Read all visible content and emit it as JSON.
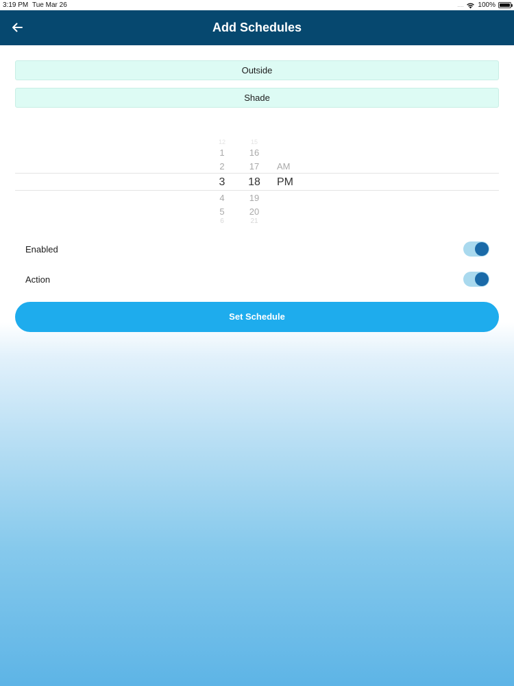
{
  "status_bar": {
    "time": "3:19 PM",
    "date": "Tue Mar 26",
    "signal": "....",
    "battery": "100%",
    "icons": [
      "wifi-icon",
      "battery-icon"
    ]
  },
  "nav": {
    "title": "Add Schedules",
    "back_icon": "arrow-left-icon",
    "color": "#06486f"
  },
  "fields": {
    "location": "Outside",
    "device": "Shade",
    "background": "#ddfbf4"
  },
  "picker": {
    "hours": [
      "12",
      "1",
      "2",
      "3",
      "4",
      "5",
      "6"
    ],
    "minutes": [
      "15",
      "16",
      "17",
      "18",
      "19",
      "20",
      "21"
    ],
    "periods": [
      "AM",
      "PM"
    ],
    "selected": {
      "hour": "3",
      "minute": "18",
      "period": "PM"
    }
  },
  "toggles": {
    "enabled": {
      "label": "Enabled",
      "on": true
    },
    "action": {
      "label": "Action",
      "on": true
    },
    "track_color": "#a9d9ee",
    "knob_color": "#1a6aa8"
  },
  "submit": {
    "label": "Set Schedule",
    "color": "#1eaced"
  }
}
